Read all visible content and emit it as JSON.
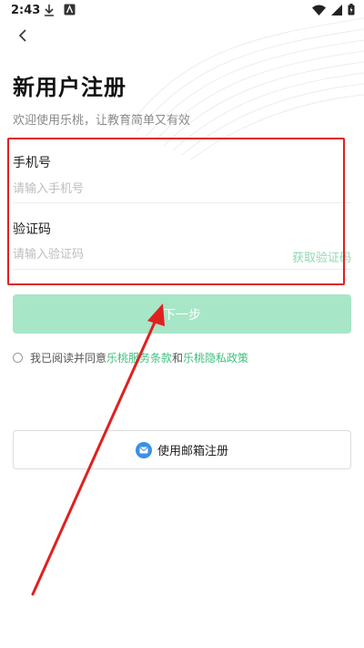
{
  "status_bar": {
    "time": "2:43"
  },
  "header": {
    "title": "新用户注册",
    "subtitle": "欢迎使用乐桃，让教育简单又有效"
  },
  "form": {
    "phone": {
      "label": "手机号",
      "placeholder": "请输入手机号",
      "value": ""
    },
    "code": {
      "label": "验证码",
      "placeholder": "请输入验证码",
      "value": "",
      "get_code_label": "获取验证码"
    }
  },
  "next_button": {
    "label": "下一步"
  },
  "agreement": {
    "prefix": "我已阅读并同意",
    "terms_link": "乐桃服务条款",
    "conjunction": "和",
    "privacy_link": "乐桃隐私政策",
    "checked": false
  },
  "email_button": {
    "label": "使用邮箱注册",
    "icon": "mail-icon"
  },
  "colors": {
    "accent": "#3fbf7f",
    "button_disabled": "#a8e6c8",
    "annotation_red": "#e02020",
    "mail_icon_bg": "#3b8fe8"
  }
}
